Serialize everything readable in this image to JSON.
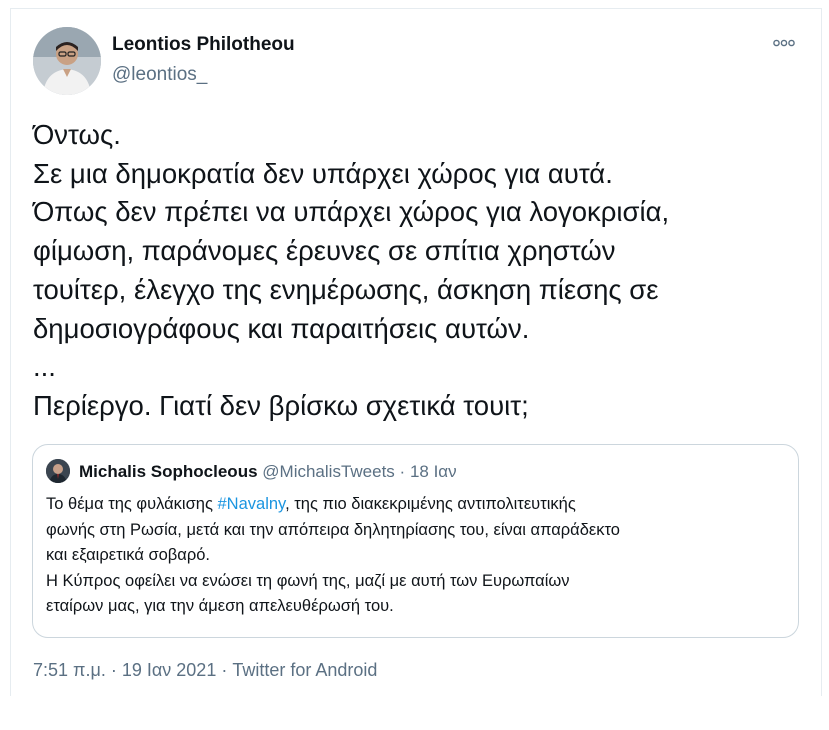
{
  "tweet": {
    "author": {
      "name": "Leontios Philotheou",
      "handle": "@leontios_"
    },
    "text_lines": [
      "Όντως.",
      "Σε μια δημοκρατία δεν υπάρχει χώρος για αυτά.",
      "Όπως δεν πρέπει να υπάρχει χώρος για λογοκρισία,",
      "φίμωση, παράνομες έρευνες σε σπίτια χρηστών",
      "τουίτερ, έλεγχο της ενημέρωσης, άσκηση πίεσης σε",
      "δημοσιογράφους και παραιτήσεις αυτών.",
      "...",
      "Περίεργο. Γιατί δεν βρίσκω σχετικά τουιτ;"
    ],
    "quoted": {
      "name": "Michalis Sophocleous",
      "handle": "@MichalisTweets",
      "separator": "·",
      "date": "18 Ιαν",
      "line1_before": "Το θέμα της φυλάκισης ",
      "line1_hashtag": "#Navalny",
      "line1_after": ", της πιο διακεκριμένης αντιπολιτευτικής",
      "lines": [
        "φωνής στη Ρωσία, μετά και την απόπειρα δηλητηρίασης του, είναι απαράδεκτο",
        "και εξαιρετικά σοβαρό.",
        "Η Κύπρος οφείλει να ενώσει τη φωνή της, μαζί με αυτή των Ευρωπαίων",
        "εταίρων μας, για την άμεση απελευθέρωσή του."
      ]
    },
    "meta": {
      "time": "7:51 π.μ.",
      "separator": "·",
      "date": "19 Ιαν 2021",
      "source": "Twitter for Android"
    }
  },
  "colors": {
    "text": "#0f1419",
    "secondary": "#5b7083",
    "link": "#1b95e0",
    "border": "#ccd6dd"
  },
  "icons": {
    "more": "more-horizontal-icon"
  }
}
